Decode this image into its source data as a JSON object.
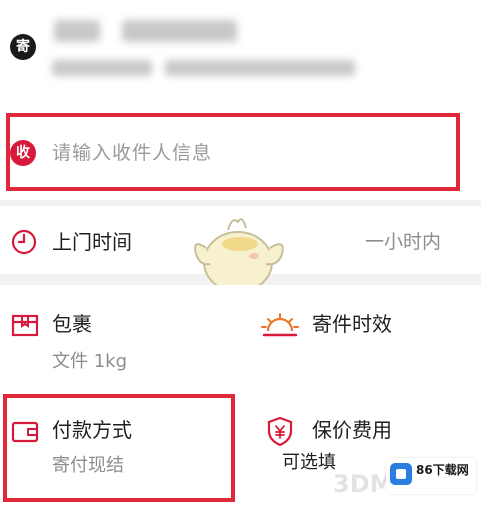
{
  "sender": {
    "badge": "寄"
  },
  "receiver": {
    "badge": "收",
    "placeholder": "请输入收件人信息"
  },
  "pickup_time": {
    "label": "上门时间",
    "value": "一小时内"
  },
  "package": {
    "label": "包裹",
    "value": "文件 1kg"
  },
  "delivery_time": {
    "label": "寄件时效"
  },
  "payment": {
    "label": "付款方式",
    "value": "寄付现结"
  },
  "insurance": {
    "label": "保价费用",
    "value": "可选填"
  },
  "watermarks": {
    "site_86": "86下载网",
    "site_3dm": "3DM"
  },
  "colors": {
    "accent_red": "#e0283a",
    "badge_red": "#d71a3b",
    "icon_red": "#d71a3b",
    "sun_orange": "#e8772a"
  }
}
